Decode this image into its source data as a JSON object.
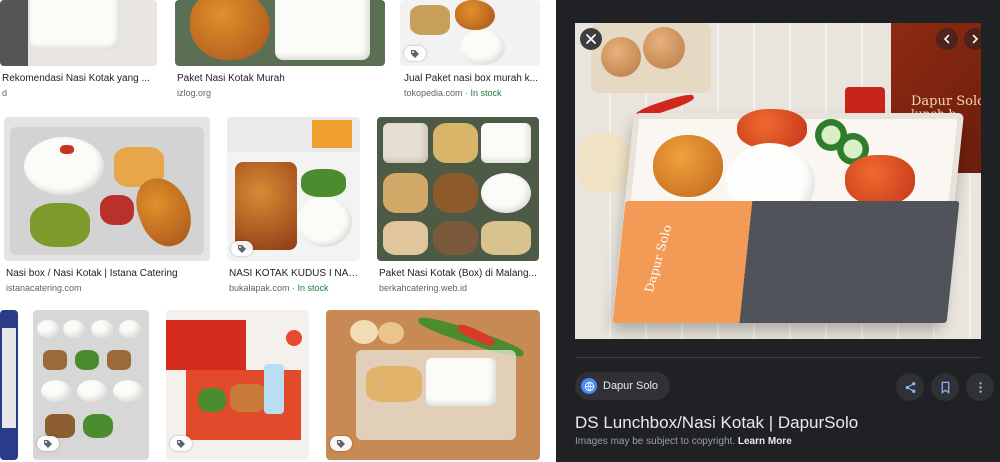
{
  "results": [
    {
      "caption": "Rekomendasi Nasi Kotak yang ...",
      "source": "d",
      "stock": ""
    },
    {
      "caption": "Paket Nasi Kotak Murah",
      "source": "izlog.org",
      "stock": ""
    },
    {
      "caption": "Jual Paket nasi box murah k...",
      "source": "tokopedia.com",
      "stock": "In stock"
    },
    {
      "caption": "Nasi box / Nasi Kotak | Istana Catering",
      "source": "istanacatering.com",
      "stock": ""
    },
    {
      "caption": "NASI KOTAK KUDUS I NASI ...",
      "source": "bukalapak.com",
      "stock": "In stock"
    },
    {
      "caption": "Paket Nasi Kotak (Box) di Malang...",
      "source": "berkahcatering.web.id",
      "stock": ""
    }
  ],
  "stock_separator": " · ",
  "preview": {
    "brand_text": "Dapur Solo",
    "box_logo_text": "Dapur Solo",
    "box_brand_line2": "lunch b",
    "source_name": "Dapur Solo",
    "title": "DS Lunchbox/Nasi Kotak | DapurSolo",
    "note": "Images may be subject to copyright.",
    "learn_more": "Learn More"
  },
  "icons": {
    "tag": "price-tag-icon",
    "close": "close-icon",
    "prev": "chevron-left-icon",
    "next": "chevron-right-icon",
    "favicon": "globe-icon",
    "share": "share-icon",
    "save": "bookmark-icon",
    "more": "more-vert-icon"
  },
  "colors": {
    "panel_bg": "#202124",
    "in_stock": "#188038",
    "link_text": "#e8eaed"
  }
}
